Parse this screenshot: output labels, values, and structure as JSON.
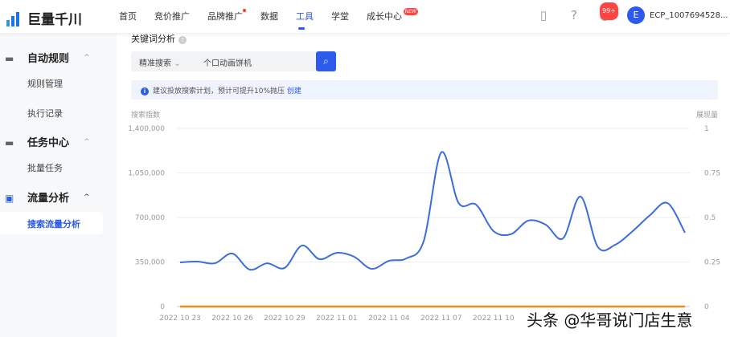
{
  "header": {
    "logo": "巨量千川",
    "nav": [
      {
        "label": "首页"
      },
      {
        "label": "竞价推广"
      },
      {
        "label": "品牌推广"
      },
      {
        "label": "数据"
      },
      {
        "label": "工具"
      },
      {
        "label": "学堂"
      },
      {
        "label": "成长中心"
      }
    ],
    "new_badge": "NEW",
    "notif_badge": "99+",
    "avatar_letter": "E",
    "account": "ECP_1007694528..."
  },
  "sidebar": {
    "groups": [
      {
        "label": "自动规则",
        "items": [
          "规则管理",
          "执行记录"
        ]
      },
      {
        "label": "任务中心",
        "items": [
          "批量任务"
        ]
      },
      {
        "label": "流量分析",
        "items": [
          "搜索流量分析"
        ]
      }
    ]
  },
  "main": {
    "title": "关键词分析",
    "search_type": "精准搜索",
    "search_value": "个口动画饼机",
    "tip_text": "建议投放搜索计划，预计可提升10%抛压",
    "tip_link": "创建"
  },
  "chart_data": {
    "type": "line",
    "ylabel_left": "搜索指数",
    "ylabel_right": "展现量",
    "yticks_left": [
      "0",
      "350,000",
      "700,000",
      "1,050,000",
      "1,400,000"
    ],
    "ylim_left": [
      0,
      1400000
    ],
    "yticks_right": [
      "0",
      "0.25",
      "0.5",
      "0.75",
      "1"
    ],
    "ylim_right": [
      0,
      1
    ],
    "xtick_labels": [
      "2022 10 23",
      "2022 10 26",
      "2022 10 29",
      "2022 11 01",
      "2022 11 04",
      "2022 11 07",
      "2022 11 10"
    ],
    "series": [
      {
        "name": "搜索指数",
        "color": "#3b6ce0",
        "values": [
          347000,
          353000,
          340000,
          416000,
          290000,
          340000,
          303000,
          479000,
          372000,
          422000,
          391000,
          296000,
          359000,
          378000,
          517000,
          1211000,
          813000,
          801000,
          593000,
          568000,
          675000,
          643000,
          536000,
          864000,
          467000,
          486000,
          593000,
          719000,
          813000,
          580000
        ]
      },
      {
        "name": "展现量",
        "color": "#f08c1c",
        "values": [
          0,
          0,
          0,
          0,
          0,
          0,
          0,
          0,
          0,
          0,
          0,
          0,
          0,
          0,
          0,
          0,
          0,
          0,
          0,
          0,
          0,
          0,
          0,
          0,
          0,
          0,
          0,
          0,
          0,
          0
        ]
      }
    ]
  },
  "watermark": "头条 @华哥说门店生意"
}
